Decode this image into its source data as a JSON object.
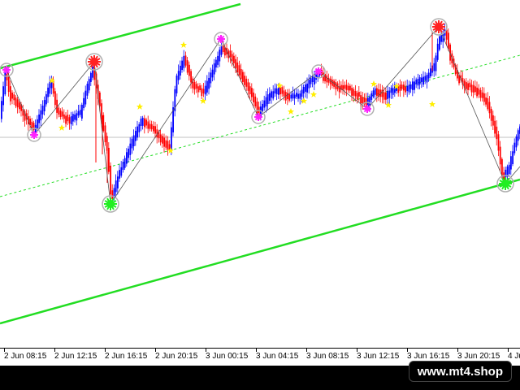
{
  "time_axis": {
    "labels": [
      "2 Jun 08:15",
      "2 Jun 12:15",
      "2 Jun 16:15",
      "2 Jun 20:15",
      "3 Jun 00:15",
      "3 Jun 04:15",
      "3 Jun 08:15",
      "3 Jun 12:15",
      "3 Jun 16:15",
      "3 Jun 20:15",
      "4 Ju"
    ]
  },
  "watermark": {
    "text": "www.mt4.shop"
  },
  "colors": {
    "bull_candle": "#0000ff",
    "bear_candle": "#ff0000",
    "channel_line": "#22dd22",
    "mid_line": "#22dd22",
    "horizontal_line": "#c0c0c0",
    "zigzag": "#555555",
    "top_marker": "#ff2222",
    "bottom_marker": "#22ee22",
    "swing_star": "#ff22ff",
    "minor_star": "#ffee00",
    "ring": "#b0b0b0"
  },
  "markers": {
    "major_top": "red-sun-marker",
    "major_bottom": "green-sun-marker",
    "swing_point": "magenta-star-ring-marker",
    "minor_point": "yellow-star-marker"
  }
}
